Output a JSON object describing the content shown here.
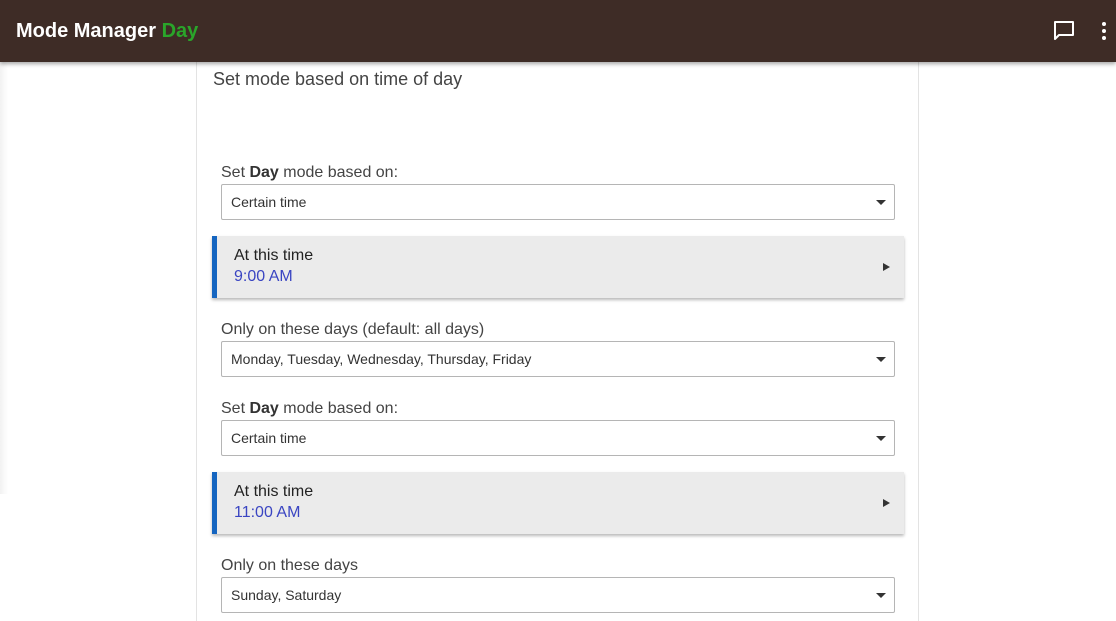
{
  "header": {
    "app_name": "Mode Manager",
    "mode_name": "Day",
    "chat_icon": "chat-bubble-icon",
    "more_icon": "more-vertical-icon",
    "colors": {
      "bar": "#3e2c26",
      "mode": "#2aa52a"
    }
  },
  "card": {
    "heading": "Set mode based on time of day",
    "section1": {
      "label_prefix": "Set ",
      "label_bold": "Day",
      "label_suffix": " mode based on:",
      "select_value": "Certain time",
      "time_label": "At this time",
      "time_value": "9:00 AM",
      "days_label": "Only on these days (default: all days)",
      "days_value": "Monday, Tuesday, Wednesday, Thursday, Friday"
    },
    "section2": {
      "label_prefix": "Set ",
      "label_bold": "Day",
      "label_suffix": " mode based on:",
      "select_value": "Certain time",
      "time_label": "At this time",
      "time_value": "11:00 AM",
      "days_label": "Only on these days",
      "days_value": "Sunday, Saturday"
    }
  },
  "accent_colors": {
    "time_card_border": "#1565c0",
    "time_value": "#3a45c2"
  }
}
